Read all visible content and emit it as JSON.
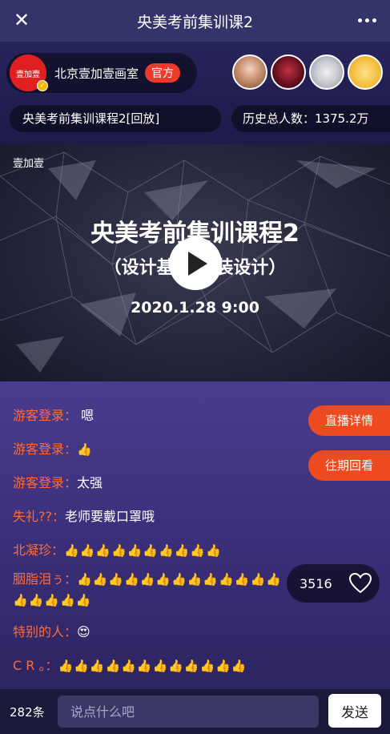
{
  "topbar": {
    "title": "央美考前集训课2"
  },
  "studio": {
    "name": "北京壹加壹画室",
    "badge": "官方",
    "logo_text": "壹加壹"
  },
  "viewer_avatars": [
    "avatar-1",
    "avatar-2",
    "avatar-3",
    "avatar-4"
  ],
  "info": {
    "replay_title": "央美考前集训课程2[回放]",
    "history_count": "历史总人数：1375.2万"
  },
  "video": {
    "brand": "壹加壹",
    "title": "央美考前集训课程2",
    "subtitle": "（设计基础  包装设计）",
    "datetime": "2020.1.28  9:00"
  },
  "side_buttons": {
    "live_detail": "直播详情",
    "past_replay": "往期回看"
  },
  "likes": {
    "count": "3516"
  },
  "chat": [
    {
      "user": "游客登录：",
      "text": " 嗯"
    },
    {
      "user": "游客登录：",
      "text": "👍"
    },
    {
      "user": "游客登录：",
      "text": "太强"
    },
    {
      "user": "失礼??：",
      "text": "老师要戴口罩哦"
    },
    {
      "user": "北凝珍：",
      "text": "👍👍👍👍👍👍👍👍👍👍"
    },
    {
      "user": "胭脂泪ぅ：",
      "text": "👍👍👍👍👍👍👍👍👍👍👍👍👍👍👍👍👍👍"
    },
    {
      "user": "特别的人：",
      "text": "😍"
    },
    {
      "user": "C R 。：",
      "text": "👍👍👍👍👍👍👍👍👍👍👍👍"
    }
  ],
  "bottombar": {
    "count": "282条",
    "placeholder": "说点什么吧",
    "send_label": "发送"
  },
  "colors": {
    "accent": "#ee4a20",
    "username": "#ff6a3a"
  }
}
